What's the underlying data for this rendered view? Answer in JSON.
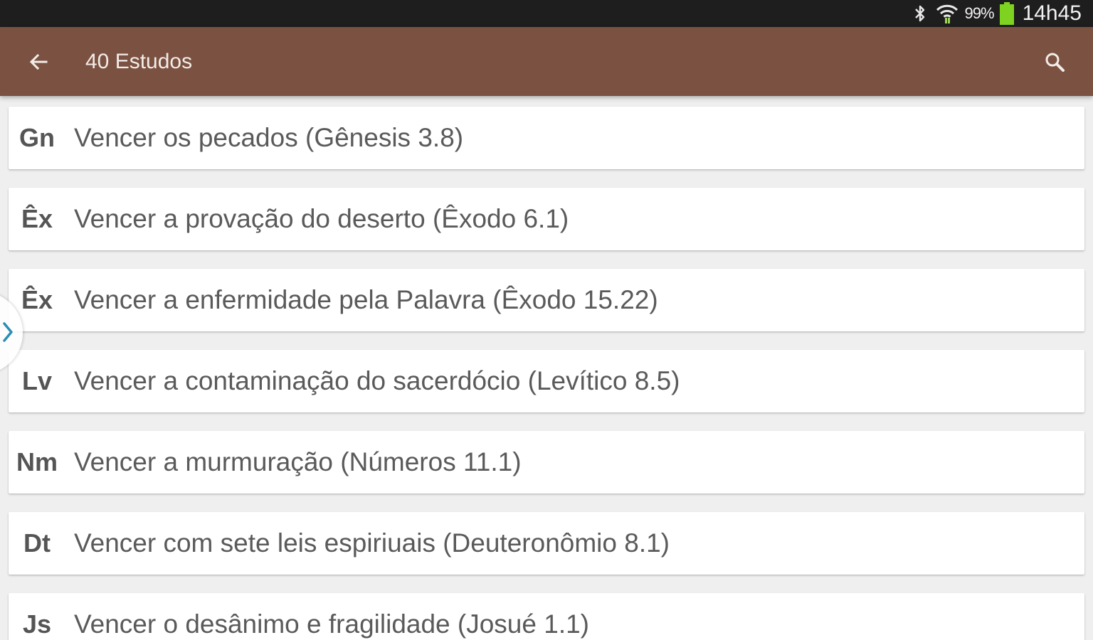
{
  "status_bar": {
    "battery_percent": "99%",
    "time": "14h45",
    "icons": [
      "bluetooth-icon",
      "wifi-icon",
      "battery-icon"
    ],
    "battery_color": "#7ed321"
  },
  "app_bar": {
    "title": "40 Estudos",
    "back_icon": "arrow-left-icon",
    "search_icon": "search-icon",
    "color": "#7b5242"
  },
  "drawer_handle": {
    "icon": "chevron-right-icon",
    "color": "#2a8fb4"
  },
  "studies": [
    {
      "abbr": "Gn",
      "title": "Vencer os pecados (Gênesis 3.8)"
    },
    {
      "abbr": "Êx",
      "title": "Vencer a provação do deserto (Êxodo 6.1)"
    },
    {
      "abbr": "Êx",
      "title": "Vencer a enfermidade pela Palavra (Êxodo 15.22)"
    },
    {
      "abbr": "Lv",
      "title": "Vencer a contaminação do sacerdócio (Levítico 8.5)"
    },
    {
      "abbr": "Nm",
      "title": "Vencer a murmuração (Números 11.1)"
    },
    {
      "abbr": "Dt",
      "title": "Vencer com sete leis espiriuais (Deuteronômio 8.1)"
    },
    {
      "abbr": "Js",
      "title": "Vencer o desânimo e fragilidade (Josué 1.1)"
    }
  ]
}
